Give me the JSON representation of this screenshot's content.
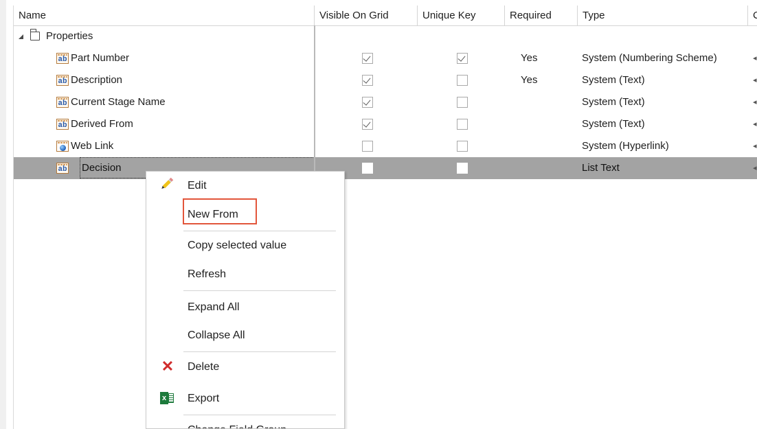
{
  "grid": {
    "columns": {
      "name": "Name",
      "visible_on_grid": "Visible On Grid",
      "unique_key": "Unique Key",
      "required": "Required",
      "type": "Type",
      "overflow": "C"
    },
    "group": {
      "label": "Properties",
      "icon": "folder-icon",
      "expanded": true
    },
    "rows": [
      {
        "name": "Part Number",
        "icon": "text-field-icon",
        "visible_on_grid": true,
        "unique_key": true,
        "required": "Yes",
        "type": "System (Numbering Scheme)"
      },
      {
        "name": "Description",
        "icon": "text-field-icon",
        "visible_on_grid": true,
        "unique_key": false,
        "required": "Yes",
        "type": "System (Text)"
      },
      {
        "name": "Current Stage Name",
        "icon": "text-field-icon",
        "visible_on_grid": true,
        "unique_key": false,
        "required": "",
        "type": "System (Text)"
      },
      {
        "name": "Derived From",
        "icon": "text-field-icon",
        "visible_on_grid": true,
        "unique_key": false,
        "required": "",
        "type": "System (Text)"
      },
      {
        "name": "Web Link",
        "icon": "hyperlink-field-icon",
        "visible_on_grid": false,
        "unique_key": false,
        "required": "",
        "type": "System (Hyperlink)"
      },
      {
        "name": "Decision",
        "icon": "text-field-icon",
        "visible_on_grid": false,
        "unique_key": false,
        "required": "",
        "type": "List Text",
        "selected": true
      }
    ],
    "ab_glyph": "ab"
  },
  "context_menu": {
    "items": [
      {
        "label": "Edit",
        "icon": "pencil-icon"
      },
      {
        "label": "New From",
        "highlighted": true
      },
      {
        "label": "Copy selected value"
      },
      {
        "label": "Refresh"
      },
      {
        "label": "Expand All"
      },
      {
        "label": "Collapse All"
      },
      {
        "label": "Delete",
        "icon": "delete-x-icon"
      },
      {
        "label": "Export",
        "icon": "excel-icon"
      },
      {
        "label": "Change Field Group",
        "icon": "field-group-icon"
      }
    ],
    "excel_glyph": "x",
    "delete_glyph": "✕"
  },
  "colors": {
    "selected_row": "#a3a3a3",
    "highlight_box": "#e2553a",
    "delete_icon": "#d02b2b",
    "excel_green": "#1d7a3c"
  }
}
